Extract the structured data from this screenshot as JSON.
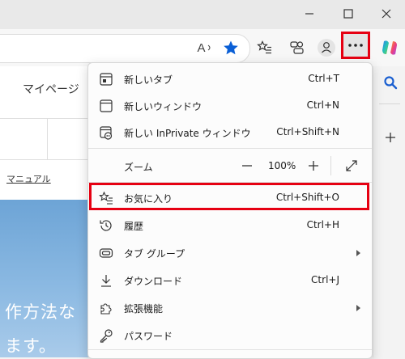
{
  "toolbar": {
    "read_aloud_text": "A"
  },
  "page": {
    "mypage": "マイページ",
    "manual": "マニュアル",
    "hero_line1": "作方法な",
    "hero_line2": "ます。"
  },
  "menu": {
    "new_tab": {
      "label": "新しいタブ",
      "shortcut": "Ctrl+T"
    },
    "new_window": {
      "label": "新しいウィンドウ",
      "shortcut": "Ctrl+N"
    },
    "new_inprivate": {
      "label": "新しい InPrivate ウィンドウ",
      "shortcut": "Ctrl+Shift+N"
    },
    "zoom": {
      "label": "ズーム",
      "value": "100%",
      "minus": "—",
      "plus": "+"
    },
    "favorites": {
      "label": "お気に入り",
      "shortcut": "Ctrl+Shift+O"
    },
    "history": {
      "label": "履歴",
      "shortcut": "Ctrl+H"
    },
    "tab_groups": {
      "label": "タブ グループ"
    },
    "downloads": {
      "label": "ダウンロード",
      "shortcut": "Ctrl+J"
    },
    "extensions": {
      "label": "拡張機能"
    },
    "passwords": {
      "label": "パスワード"
    }
  },
  "colors": {
    "accent_blue": "#0a5fd6",
    "highlight_red": "#e60012"
  }
}
